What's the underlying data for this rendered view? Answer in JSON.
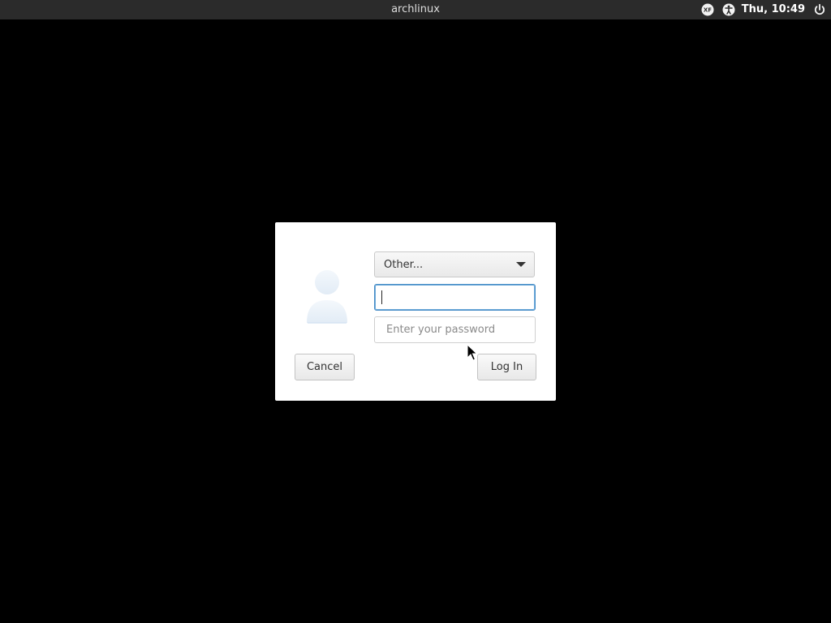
{
  "panel": {
    "hostname": "archlinux",
    "clock": "Thu, 10:49",
    "icons": [
      "xf-indicator-icon",
      "accessibility-icon",
      "power-icon"
    ]
  },
  "dialog": {
    "user_select": {
      "selected": "Other..."
    },
    "username": {
      "value": ""
    },
    "password": {
      "placeholder": "Enter your password"
    },
    "cancel_label": "Cancel",
    "login_label": "Log In"
  },
  "colors": {
    "panel_bg": "#2b2b2b",
    "focus_ring": "#4a8fc8",
    "desktop_bg": "#000000"
  }
}
